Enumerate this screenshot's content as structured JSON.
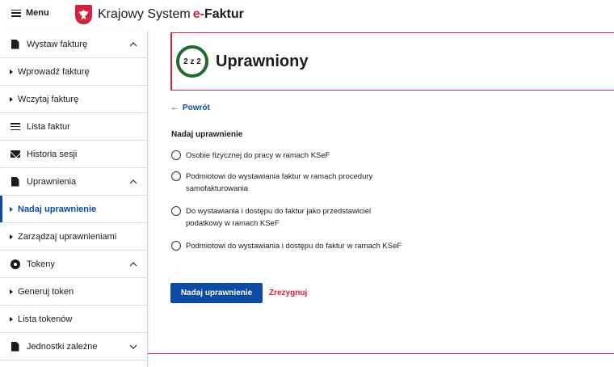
{
  "header": {
    "menu_label": "Menu",
    "brand_main": "Krajowy System",
    "brand_e": "e-",
    "brand_faktur": "Faktur"
  },
  "sidebar": {
    "items": [
      {
        "label": "Wystaw fakturę",
        "type": "section",
        "icon": "document-icon",
        "chevron": "up"
      },
      {
        "label": "Wprowadź fakturę",
        "type": "sub"
      },
      {
        "label": "Wczytaj fakturę",
        "type": "sub"
      },
      {
        "label": "Lista faktur",
        "type": "section",
        "icon": "list-icon"
      },
      {
        "label": "Historia sesji",
        "type": "section",
        "icon": "mail-icon"
      },
      {
        "label": "Uprawnienia",
        "type": "section",
        "icon": "document-icon",
        "chevron": "up"
      },
      {
        "label": "Nadaj uprawnienie",
        "type": "sub",
        "active": true
      },
      {
        "label": "Zarządzaj uprawnieniami",
        "type": "sub"
      },
      {
        "label": "Tokeny",
        "type": "section",
        "icon": "token-icon",
        "chevron": "up"
      },
      {
        "label": "Generuj token",
        "type": "sub"
      },
      {
        "label": "Lista tokenów",
        "type": "sub"
      },
      {
        "label": "Jednostki zależne",
        "type": "section",
        "icon": "document-icon",
        "chevron": "down"
      }
    ]
  },
  "main": {
    "step": "2 z 2",
    "title": "Uprawniony",
    "back_label": "Powrót",
    "legend": "Nadaj uprawnienie",
    "options": [
      "Osobie fizycznej do pracy w ramach KSeF",
      "Podmiotowi do wystawiania faktur w ramach procedury samofakturowania",
      "Do wystawiania i dostępu do faktur jako przedstawiciel podatkowy w ramach KSeF",
      "Podmiotowi do wystawiania i dostępu do faktur w ramach KSeF"
    ],
    "submit_label": "Nadaj uprawnienie",
    "cancel_label": "Zrezygnuj"
  },
  "colors": {
    "accent_blue": "#0c4aa6",
    "accent_red": "#d4213d",
    "step_green": "#1e6b2b"
  }
}
